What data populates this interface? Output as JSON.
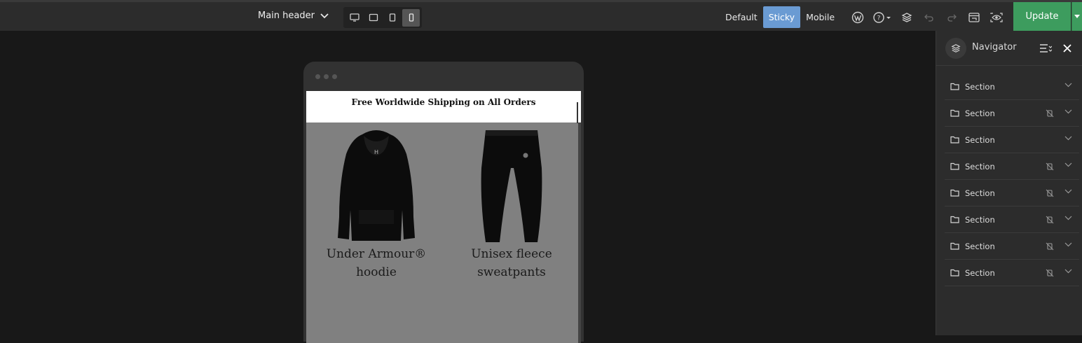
{
  "header": {
    "title": "Main header",
    "device_modes": [
      "desktop-icon",
      "laptop-icon",
      "tablet-icon",
      "mobile-icon"
    ],
    "active_device": "mobile",
    "states": [
      "Default",
      "Sticky",
      "Mobile"
    ],
    "active_state": "Sticky",
    "update_label": "Update",
    "accent": "#3d9c5e",
    "state_accent": "#6a9bd3"
  },
  "preview": {
    "banner": "Free Worldwide Shipping on All Orders",
    "products": [
      {
        "name_line1": "Under Armour®",
        "name_line2": "hoodie"
      },
      {
        "name_line1": "Unisex fleece",
        "name_line2": "sweatpants"
      }
    ]
  },
  "navigator": {
    "title": "Navigator",
    "items": [
      {
        "label": "Section",
        "hidden": false
      },
      {
        "label": "Section",
        "hidden": true
      },
      {
        "label": "Section",
        "hidden": false
      },
      {
        "label": "Section",
        "hidden": true
      },
      {
        "label": "Section",
        "hidden": true
      },
      {
        "label": "Section",
        "hidden": true
      },
      {
        "label": "Section",
        "hidden": true
      },
      {
        "label": "Section",
        "hidden": true
      }
    ]
  }
}
